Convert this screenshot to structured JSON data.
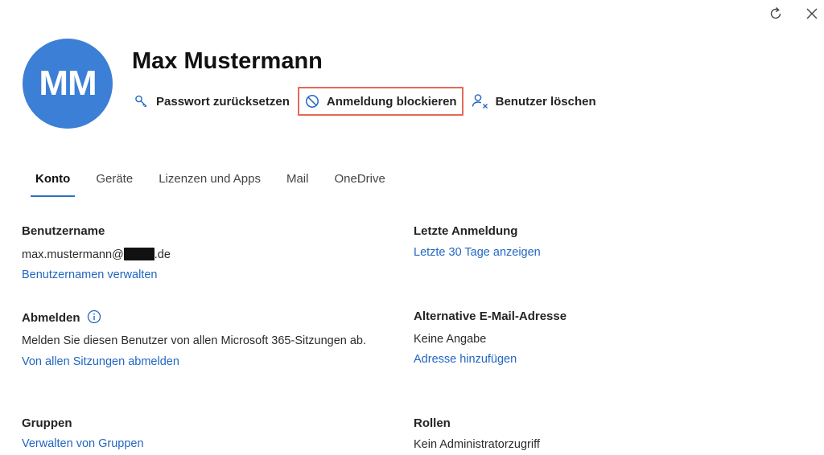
{
  "window": {
    "refresh_icon": "refresh-icon",
    "close_icon": "close-icon"
  },
  "profile": {
    "initials": "MM",
    "name": "Max Mustermann",
    "avatar_color": "#3b7fd6"
  },
  "actions": {
    "reset_password": "Passwort zurücksetzen",
    "block_signin": "Anmeldung blockieren",
    "delete_user": "Benutzer löschen",
    "highlight_color": "#e36a5a"
  },
  "tabs": [
    {
      "label": "Konto",
      "active": true
    },
    {
      "label": "Geräte"
    },
    {
      "label": "Lizenzen und Apps"
    },
    {
      "label": "Mail"
    },
    {
      "label": "OneDrive"
    }
  ],
  "account": {
    "username": {
      "label": "Benutzername",
      "value_prefix": "max.mustermann@",
      "value_suffix": ".de",
      "link": "Benutzernamen verwalten"
    },
    "signout": {
      "label": "Abmelden",
      "description": "Melden Sie diesen Benutzer von allen Microsoft 365-Sitzungen ab.",
      "link": "Von allen Sitzungen abmelden"
    },
    "groups": {
      "label": "Gruppen",
      "link": "Verwalten von Gruppen"
    },
    "last_signin": {
      "label": "Letzte Anmeldung",
      "link": "Letzte 30 Tage anzeigen"
    },
    "alt_email": {
      "label": "Alternative E-Mail-Adresse",
      "value": "Keine Angabe",
      "link": "Adresse hinzufügen"
    },
    "roles": {
      "label": "Rollen",
      "value": "Kein Administratorzugriff"
    }
  },
  "colors": {
    "link": "#2266c2",
    "tab_underline": "#2b71c7"
  }
}
